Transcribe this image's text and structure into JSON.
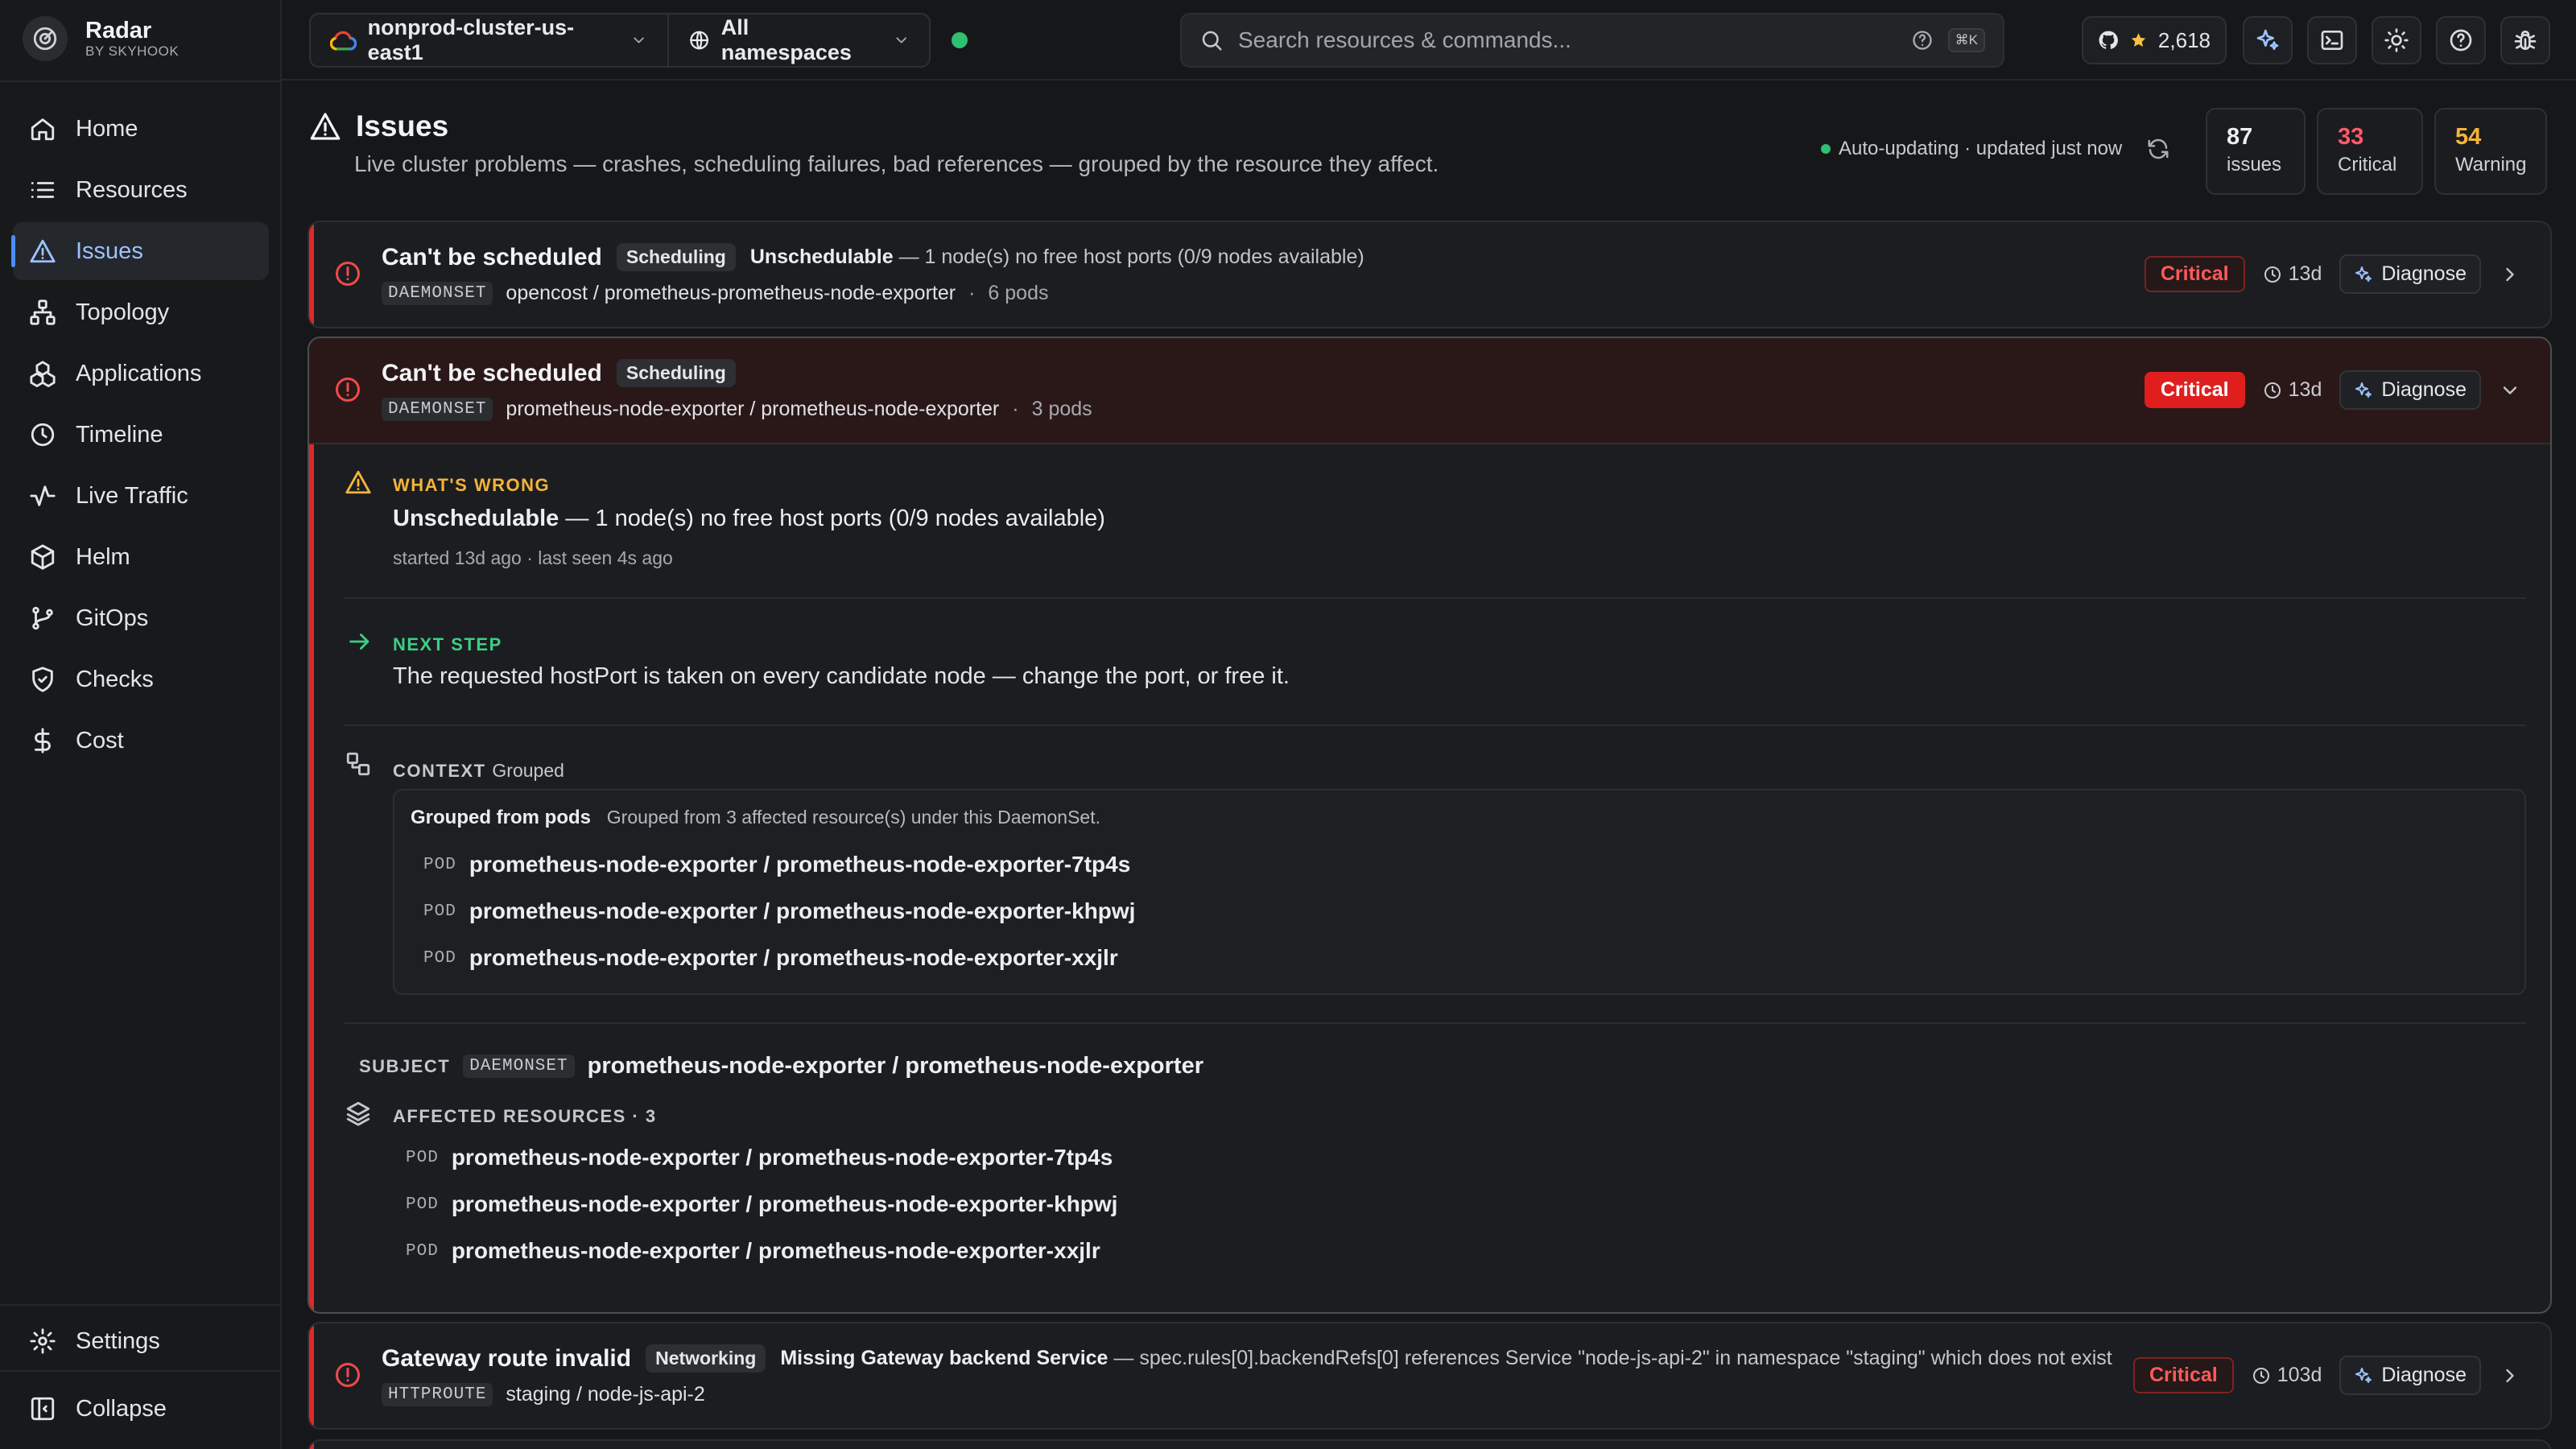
{
  "app": {
    "name": "Radar",
    "sub": "BY SKYHOOK"
  },
  "sidebar": {
    "items": [
      {
        "label": "Home",
        "icon": "home-icon"
      },
      {
        "label": "Resources",
        "icon": "list-icon"
      },
      {
        "label": "Issues",
        "icon": "warning-icon",
        "active": true
      },
      {
        "label": "Topology",
        "icon": "topology-icon"
      },
      {
        "label": "Applications",
        "icon": "applications-icon"
      },
      {
        "label": "Timeline",
        "icon": "clock-icon"
      },
      {
        "label": "Live Traffic",
        "icon": "activity-icon"
      },
      {
        "label": "Helm",
        "icon": "package-icon"
      },
      {
        "label": "GitOps",
        "icon": "git-branch-icon"
      },
      {
        "label": "Checks",
        "icon": "shield-check-icon"
      },
      {
        "label": "Cost",
        "icon": "dollar-icon"
      }
    ],
    "settings": "Settings",
    "collapse": "Collapse"
  },
  "topbar": {
    "cluster": "nonprod-cluster-us-east1",
    "namespace": "All namespaces",
    "search_placeholder": "Search resources & commands...",
    "kbd": "⌘K",
    "stars": "2,618"
  },
  "page": {
    "title": "Issues",
    "subtitle": "Live cluster problems — crashes, scheduling failures, bad references — grouped by the resource they affect.",
    "live_status": "Auto-updating · updated just now",
    "stats": [
      {
        "num": "87",
        "label": "issues",
        "color": "#eceef1"
      },
      {
        "num": "33",
        "label": "Critical",
        "color": "#ff5a6a"
      },
      {
        "num": "54",
        "label": "Warning",
        "color": "#f2b43a"
      }
    ]
  },
  "issues": [
    {
      "title": "Can't be scheduled",
      "tag": "Scheduling",
      "reason": "Unschedulable",
      "message": " — 1 node(s) no free host ports (0/9 nodes available)",
      "kind": "DAEMONSET",
      "resource": "opencost / prometheus-prometheus-node-exporter",
      "count": "6 pods",
      "severity": "Critical",
      "age": "13d",
      "diagnose": "Diagnose"
    },
    {
      "title": "Can't be scheduled",
      "tag": "Scheduling",
      "kind": "DAEMONSET",
      "resource": "prometheus-node-exporter / prometheus-node-exporter",
      "count": "3 pods",
      "severity": "Critical",
      "age": "13d",
      "diagnose": "Diagnose"
    },
    {
      "title": "Gateway route invalid",
      "tag": "Networking",
      "reason": "Missing Gateway backend Service",
      "message": " — spec.rules[0].backendRefs[0] references Service \"node-js-api-2\" in namespace \"staging\" which does not exist",
      "kind": "HTTPROUTE",
      "resource": "staging / node-js-api-2",
      "severity": "Critical",
      "age": "103d",
      "diagnose": "Diagnose"
    }
  ],
  "detail": {
    "wrong_label": "WHAT'S WRONG",
    "wrong_reason": "Unschedulable",
    "wrong_msg": " — 1 node(s) no free host ports (0/9 nodes available)",
    "wrong_time": "started 13d ago · last seen 4s ago",
    "next_label": "NEXT STEP",
    "next_text": "The requested hostPort is taken on every candidate node — change the port, or free it.",
    "context_label": "CONTEXT",
    "context_suffix": "Grouped",
    "grouped_title": "Grouped from pods",
    "grouped_desc": "Grouped from 3 affected resource(s) under this DaemonSet.",
    "pod_kind": "POD",
    "pods": [
      "prometheus-node-exporter / prometheus-node-exporter-7tp4s",
      "prometheus-node-exporter / prometheus-node-exporter-khpwj",
      "prometheus-node-exporter / prometheus-node-exporter-xxjlr"
    ],
    "subject_label": "SUBJECT",
    "subject_kind": "DAEMONSET",
    "subject_name": "prometheus-node-exporter / prometheus-node-exporter",
    "affected_label": "AFFECTED RESOURCES · 3"
  },
  "colors": {
    "accent": "#4b8df8",
    "critical": "#e01e1e",
    "warning": "#f2b43a",
    "ok": "#2fbf71",
    "next": "#3ccf85"
  }
}
